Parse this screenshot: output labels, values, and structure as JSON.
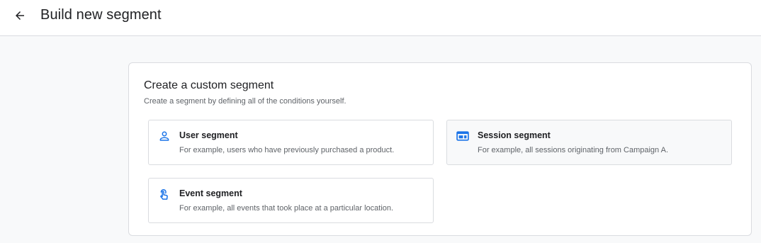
{
  "header": {
    "title": "Build new segment"
  },
  "panel": {
    "title": "Create a custom segment",
    "subtitle": "Create a segment by defining all of the conditions yourself."
  },
  "options": [
    {
      "title": "User segment",
      "description": "For example, users who have previously purchased a product.",
      "icon": "person-icon"
    },
    {
      "title": "Session segment",
      "description": "For example, all sessions originating from Campaign A.",
      "icon": "web-window-icon"
    },
    {
      "title": "Event segment",
      "description": "For example, all events that took place at a particular location.",
      "icon": "touch-hand-icon"
    }
  ],
  "colors": {
    "accent": "#1a73e8",
    "border": "#dadce0",
    "text_primary": "#202124",
    "text_secondary": "#5f6368",
    "page_background": "#f8f9fa"
  }
}
